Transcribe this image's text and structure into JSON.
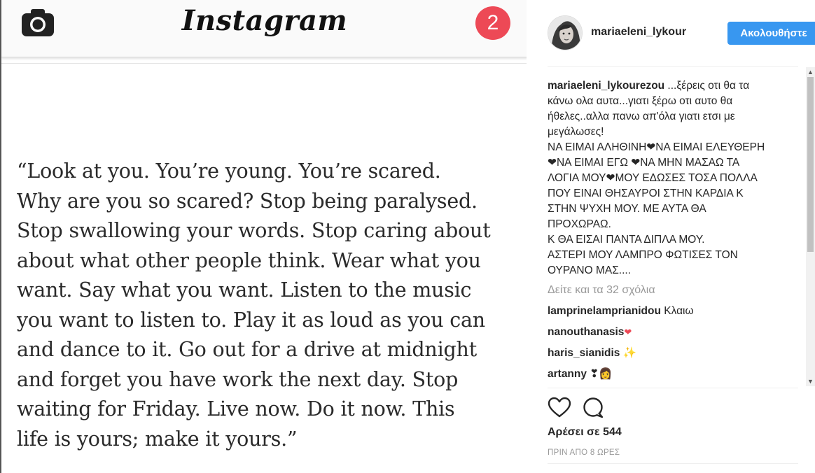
{
  "media": {
    "app_title": "Instagram",
    "notification_count": "2",
    "quote_lines": [
      "“Look at you. You’re young. You’re scared.",
      "Why are you so scared? Stop being paralysed.",
      "Stop swallowing your words. Stop caring about",
      "about what other people think. Wear what you",
      "want. Say what you want. Listen to the music",
      "you want to listen to. Play it as loud as you can",
      "and dance to it. Go out for a drive at midnight",
      "and forget you have work the next day. Stop",
      "waiting for Friday. Live now. Do it now. This",
      "life is yours; make it yours.”"
    ],
    "icons": {
      "camera": "camera-icon"
    }
  },
  "post": {
    "header": {
      "username": "mariaeleni_lykour",
      "follow_label": "Ακολουθήστε",
      "accent": "#3897f0"
    },
    "caption": {
      "author": "mariaeleni_lykourezou",
      "lines": [
        " ...ξέρεις οτι θα τα",
        "κάνω ολα αυτα...γιατι ξέρω οτι αυτο θα",
        "ήθελες..αλλα πανω απ'όλα γιατι ετσι με",
        "μεγάλωσες!",
        "ΝΑ ΕΙΜΑΙ ΑΛΗΘΙΝΗ❤ΝΑ ΕΙΜΑΙ ΕΛΕΥΘΕΡΗ",
        "❤ΝΑ ΕΙΜΑΙ ΕΓΩ ❤ΝΑ ΜΗΝ ΜΑΣΑΩ ΤΑ",
        "ΛΟΓΙΑ ΜΟΥ❤ΜΟΥ ΕΔΩΣΕΣ ΤΟΣΑ ΠΟΛΛΑ",
        "ΠΟΥ ΕΙΝΑΙ ΘΗΣΑΥΡΟΙ ΣΤΗΝ ΚΑΡΔΙΑ Κ",
        "ΣΤΗΝ ΨΥΧΗ ΜΟΥ. ΜΕ ΑΥΤΑ ΘΑ",
        "ΠΡΟΧΩΡΑΩ.",
        "Κ ΘΑ ΕΙΣΑΙ ΠΑΝΤΑ ΔΙΠΛΑ ΜΟΥ.",
        "ΑΣΤΕΡΙ ΜΟΥ ΛΑΜΠΡΟ ΦΩΤΙΣΕΣ ΤΟΝ",
        "ΟΥΡΑΝΟ ΜΑΣ...."
      ]
    },
    "view_all_comments": "Δείτε και τα 32 σχόλια",
    "comments": [
      {
        "user": "lamprinelamprianidou",
        "text": " Κλαιω"
      },
      {
        "user": "nanouthanasis",
        "text": "❤"
      },
      {
        "user": "haris_sianidis",
        "text": " ✨"
      },
      {
        "user": "artanny",
        "text": " ❣👩"
      }
    ],
    "likes": "Αρέσει σε 544",
    "timestamp": "ΠΡΙΝ ΑΠΟ 8 ΩΡΕΣ",
    "icons": {
      "like": "heart-icon",
      "comment": "comment-icon"
    }
  }
}
